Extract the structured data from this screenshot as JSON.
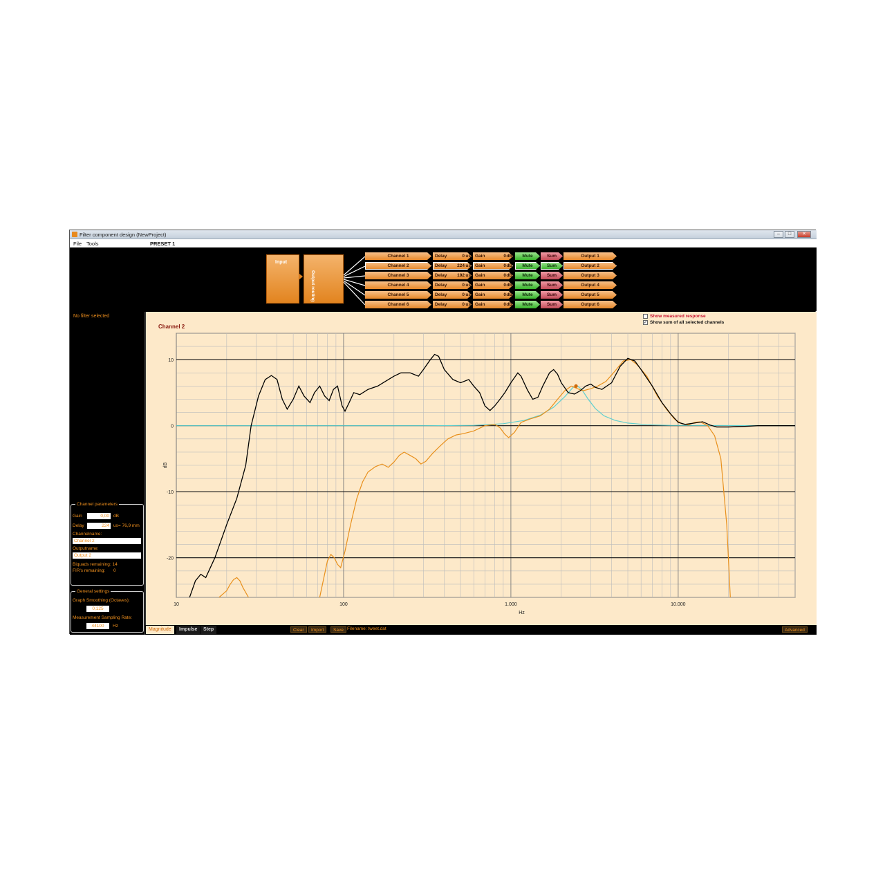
{
  "window": {
    "title": "Filter component design (NewProject)",
    "min_glyph": "–",
    "max_glyph": "□",
    "close_glyph": "✕"
  },
  "menu": {
    "file": "File",
    "tools": "Tools",
    "preset": "PRESET 1"
  },
  "routing": {
    "input_label": "Input",
    "output_routing_label": "Output routing",
    "delay_label": "Delay",
    "gain_label": "Gain",
    "delay_unit": "us",
    "gain_unit": "dB",
    "mute_label": "Mute",
    "sum_label": "Sum",
    "channels": [
      {
        "name": "Channel 1",
        "delay": "0",
        "gain": "0",
        "output": "Output 1"
      },
      {
        "name": "Channel 2",
        "delay": "224",
        "gain": "0",
        "output": "Output 2"
      },
      {
        "name": "Channel 3",
        "delay": "192",
        "gain": "0",
        "output": "Output 3"
      },
      {
        "name": "Channel 4",
        "delay": "0",
        "gain": "0",
        "output": "Output 4"
      },
      {
        "name": "Channel 5",
        "delay": "0",
        "gain": "0",
        "output": "Output 5"
      },
      {
        "name": "Channel 6",
        "delay": "0",
        "gain": "0",
        "output": "Output 6"
      }
    ],
    "sum_active": [
      false,
      true,
      false,
      false,
      false,
      false
    ]
  },
  "left": {
    "no_filter": "No filter selected",
    "channel_params": {
      "legend": "Channel parameters",
      "gain_label": "Gain",
      "gain_value": "0,00",
      "gain_unit": "dB",
      "delay_label": "Delay",
      "delay_value": "224",
      "delay_extra": "us= 76,9 mm",
      "channelname_label": "Channelname:",
      "channelname_value": "Channel 2",
      "outputname_label": "Outputname:",
      "outputname_value": "Output 2",
      "biquads": "Biquads remaining: 14",
      "firs": "FIR's remaining:",
      "firs_value": "0"
    },
    "general": {
      "legend": "General settings",
      "smoothing_label": "Graph Smoothing (Octaves):",
      "smoothing_value": "0,125",
      "sampling_label": "Measurement Sampling Rate:",
      "sampling_value": "44100",
      "sampling_unit": "Hz"
    }
  },
  "graph": {
    "show_measured": "Show measured response",
    "show_sum": "Show sum of all selected channels",
    "show_measured_checked": "",
    "show_sum_checked": "✓"
  },
  "bottom": {
    "tabs": [
      "Magnitude",
      "Impulse",
      "Step"
    ],
    "clear": "Clear",
    "import": "Import",
    "save": "Save",
    "filename": "Filename: tweet.dat",
    "advanced": "Advanced"
  },
  "colors": {
    "background": "#fde9c9",
    "sum_curve": "#000000",
    "channel_curve": "#e8901c",
    "filter_curve": "#5ecfcf",
    "accent": "#f0901e"
  },
  "chart_data": {
    "type": "line",
    "title": "Channel 2",
    "xlabel": "Hz",
    "ylabel": "dB",
    "xscale": "log",
    "xlim": [
      10,
      50000
    ],
    "ylim": [
      -26,
      14
    ],
    "x_ticks": [
      {
        "value": 10,
        "label": "10"
      },
      {
        "value": 100,
        "label": "100"
      },
      {
        "value": 1000,
        "label": "1.000"
      },
      {
        "value": 10000,
        "label": "10.000"
      }
    ],
    "y_ticks": [
      {
        "value": 10,
        "label": "10"
      },
      {
        "value": 0,
        "label": "0"
      },
      {
        "value": -10,
        "label": "-10"
      },
      {
        "value": -20,
        "label": "-20"
      }
    ],
    "grid": true,
    "series": [
      {
        "role": "sum",
        "color": "#000000",
        "points": [
          [
            12,
            -26
          ],
          [
            13,
            -23.5
          ],
          [
            14,
            -22.5
          ],
          [
            15,
            -23
          ],
          [
            17,
            -20
          ],
          [
            20,
            -15
          ],
          [
            23,
            -11
          ],
          [
            26,
            -6
          ],
          [
            28,
            0
          ],
          [
            31,
            4.5
          ],
          [
            34,
            7
          ],
          [
            37,
            7.6
          ],
          [
            40,
            7
          ],
          [
            43,
            4
          ],
          [
            46,
            2.5
          ],
          [
            50,
            4
          ],
          [
            54,
            6
          ],
          [
            58,
            4.5
          ],
          [
            63,
            3.5
          ],
          [
            67,
            5
          ],
          [
            72,
            6
          ],
          [
            77,
            4.5
          ],
          [
            82,
            3.8
          ],
          [
            87,
            5.5
          ],
          [
            92,
            6
          ],
          [
            98,
            3
          ],
          [
            102,
            2.2
          ],
          [
            108,
            3.5
          ],
          [
            115,
            5
          ],
          [
            125,
            4.7
          ],
          [
            140,
            5.5
          ],
          [
            160,
            6
          ],
          [
            180,
            6.8
          ],
          [
            200,
            7.5
          ],
          [
            220,
            8
          ],
          [
            250,
            8
          ],
          [
            280,
            7.5
          ],
          [
            300,
            8.5
          ],
          [
            330,
            10
          ],
          [
            350,
            10.8
          ],
          [
            370,
            10.5
          ],
          [
            400,
            8.5
          ],
          [
            450,
            7
          ],
          [
            500,
            6.5
          ],
          [
            560,
            7
          ],
          [
            600,
            6
          ],
          [
            650,
            5
          ],
          [
            700,
            3
          ],
          [
            750,
            2.3
          ],
          [
            800,
            3
          ],
          [
            860,
            4
          ],
          [
            920,
            5
          ],
          [
            1000,
            6.5
          ],
          [
            1100,
            8
          ],
          [
            1150,
            7.5
          ],
          [
            1250,
            5.5
          ],
          [
            1350,
            4
          ],
          [
            1450,
            4.3
          ],
          [
            1550,
            6
          ],
          [
            1700,
            8
          ],
          [
            1800,
            8.5
          ],
          [
            1900,
            7.8
          ],
          [
            2000,
            6.5
          ],
          [
            2200,
            5
          ],
          [
            2400,
            4.8
          ],
          [
            2600,
            5.3
          ],
          [
            2800,
            6
          ],
          [
            3000,
            6.3
          ],
          [
            3200,
            5.8
          ],
          [
            3500,
            5.5
          ],
          [
            4000,
            6.5
          ],
          [
            4500,
            9
          ],
          [
            5000,
            10.2
          ],
          [
            5500,
            9.8
          ],
          [
            6000,
            8.5
          ],
          [
            7000,
            6
          ],
          [
            8000,
            3.5
          ],
          [
            9000,
            1.8
          ],
          [
            10000,
            0.5
          ],
          [
            11000,
            0.2
          ],
          [
            12500,
            0.4
          ],
          [
            14000,
            0.6
          ],
          [
            15500,
            0.1
          ],
          [
            17000,
            -0.2
          ],
          [
            20000,
            -0.2
          ],
          [
            25000,
            -0.1
          ],
          [
            30000,
            0
          ],
          [
            40000,
            0
          ],
          [
            50000,
            0
          ]
        ]
      },
      {
        "role": "channel",
        "color": "#e8901c",
        "points": [
          [
            18,
            -26
          ],
          [
            19,
            -25.5
          ],
          [
            20,
            -25
          ],
          [
            21,
            -24
          ],
          [
            22,
            -23.3
          ],
          [
            23,
            -23
          ],
          [
            24,
            -23.5
          ],
          [
            25,
            -24.5
          ],
          [
            27,
            -26
          ]
        ],
        "points2": [
          [
            72,
            -26
          ],
          [
            80,
            -20.5
          ],
          [
            84,
            -19.5
          ],
          [
            88,
            -20
          ],
          [
            92,
            -21
          ],
          [
            96,
            -21.5
          ],
          [
            102,
            -19
          ],
          [
            110,
            -15
          ],
          [
            120,
            -11
          ],
          [
            130,
            -8.5
          ],
          [
            140,
            -7
          ],
          [
            155,
            -6.2
          ],
          [
            170,
            -5.8
          ],
          [
            185,
            -6.3
          ],
          [
            200,
            -5.5
          ],
          [
            215,
            -4.5
          ],
          [
            230,
            -4
          ],
          [
            250,
            -4.5
          ],
          [
            270,
            -5
          ],
          [
            290,
            -5.8
          ],
          [
            310,
            -5.4
          ],
          [
            340,
            -4.2
          ],
          [
            380,
            -3
          ],
          [
            420,
            -2
          ],
          [
            470,
            -1.4
          ],
          [
            520,
            -1.2
          ],
          [
            600,
            -0.8
          ],
          [
            700,
            0
          ],
          [
            800,
            0.2
          ],
          [
            860,
            -0.3
          ],
          [
            920,
            -1.3
          ],
          [
            970,
            -1.8
          ],
          [
            1050,
            -1
          ],
          [
            1150,
            0.5
          ],
          [
            1300,
            1
          ],
          [
            1500,
            1.5
          ],
          [
            1700,
            2.5
          ],
          [
            1900,
            4
          ],
          [
            2100,
            5.3
          ],
          [
            2300,
            6
          ],
          [
            2500,
            5.6
          ],
          [
            2700,
            5.3
          ],
          [
            3000,
            5.6
          ],
          [
            3300,
            6
          ],
          [
            3700,
            6.7
          ],
          [
            4200,
            8.3
          ],
          [
            4700,
            9.8
          ],
          [
            5200,
            10
          ],
          [
            5700,
            9.2
          ],
          [
            6500,
            7.5
          ],
          [
            7500,
            4.5
          ],
          [
            8500,
            2.5
          ],
          [
            9500,
            1
          ],
          [
            10500,
            0.3
          ],
          [
            11500,
            0.1
          ],
          [
            12500,
            0.5
          ],
          [
            13500,
            0.6
          ],
          [
            15000,
            0
          ],
          [
            16500,
            -1.5
          ],
          [
            18000,
            -5
          ],
          [
            19500,
            -15
          ],
          [
            20500,
            -26
          ]
        ]
      },
      {
        "role": "filter",
        "color": "#5ecfcf",
        "points": [
          [
            10,
            0
          ],
          [
            300,
            0
          ],
          [
            600,
            0.05
          ],
          [
            900,
            0.3
          ],
          [
            1200,
            0.8
          ],
          [
            1500,
            1.6
          ],
          [
            1800,
            2.8
          ],
          [
            2100,
            4.4
          ],
          [
            2350,
            5.8
          ],
          [
            2500,
            6
          ],
          [
            2650,
            5.5
          ],
          [
            2900,
            4
          ],
          [
            3200,
            2.6
          ],
          [
            3600,
            1.5
          ],
          [
            4200,
            0.8
          ],
          [
            5000,
            0.4
          ],
          [
            6500,
            0.15
          ],
          [
            9000,
            0.05
          ],
          [
            50000,
            0
          ]
        ]
      }
    ],
    "marker": {
      "x": 2450,
      "y": 6,
      "color": "#d06a08"
    }
  }
}
